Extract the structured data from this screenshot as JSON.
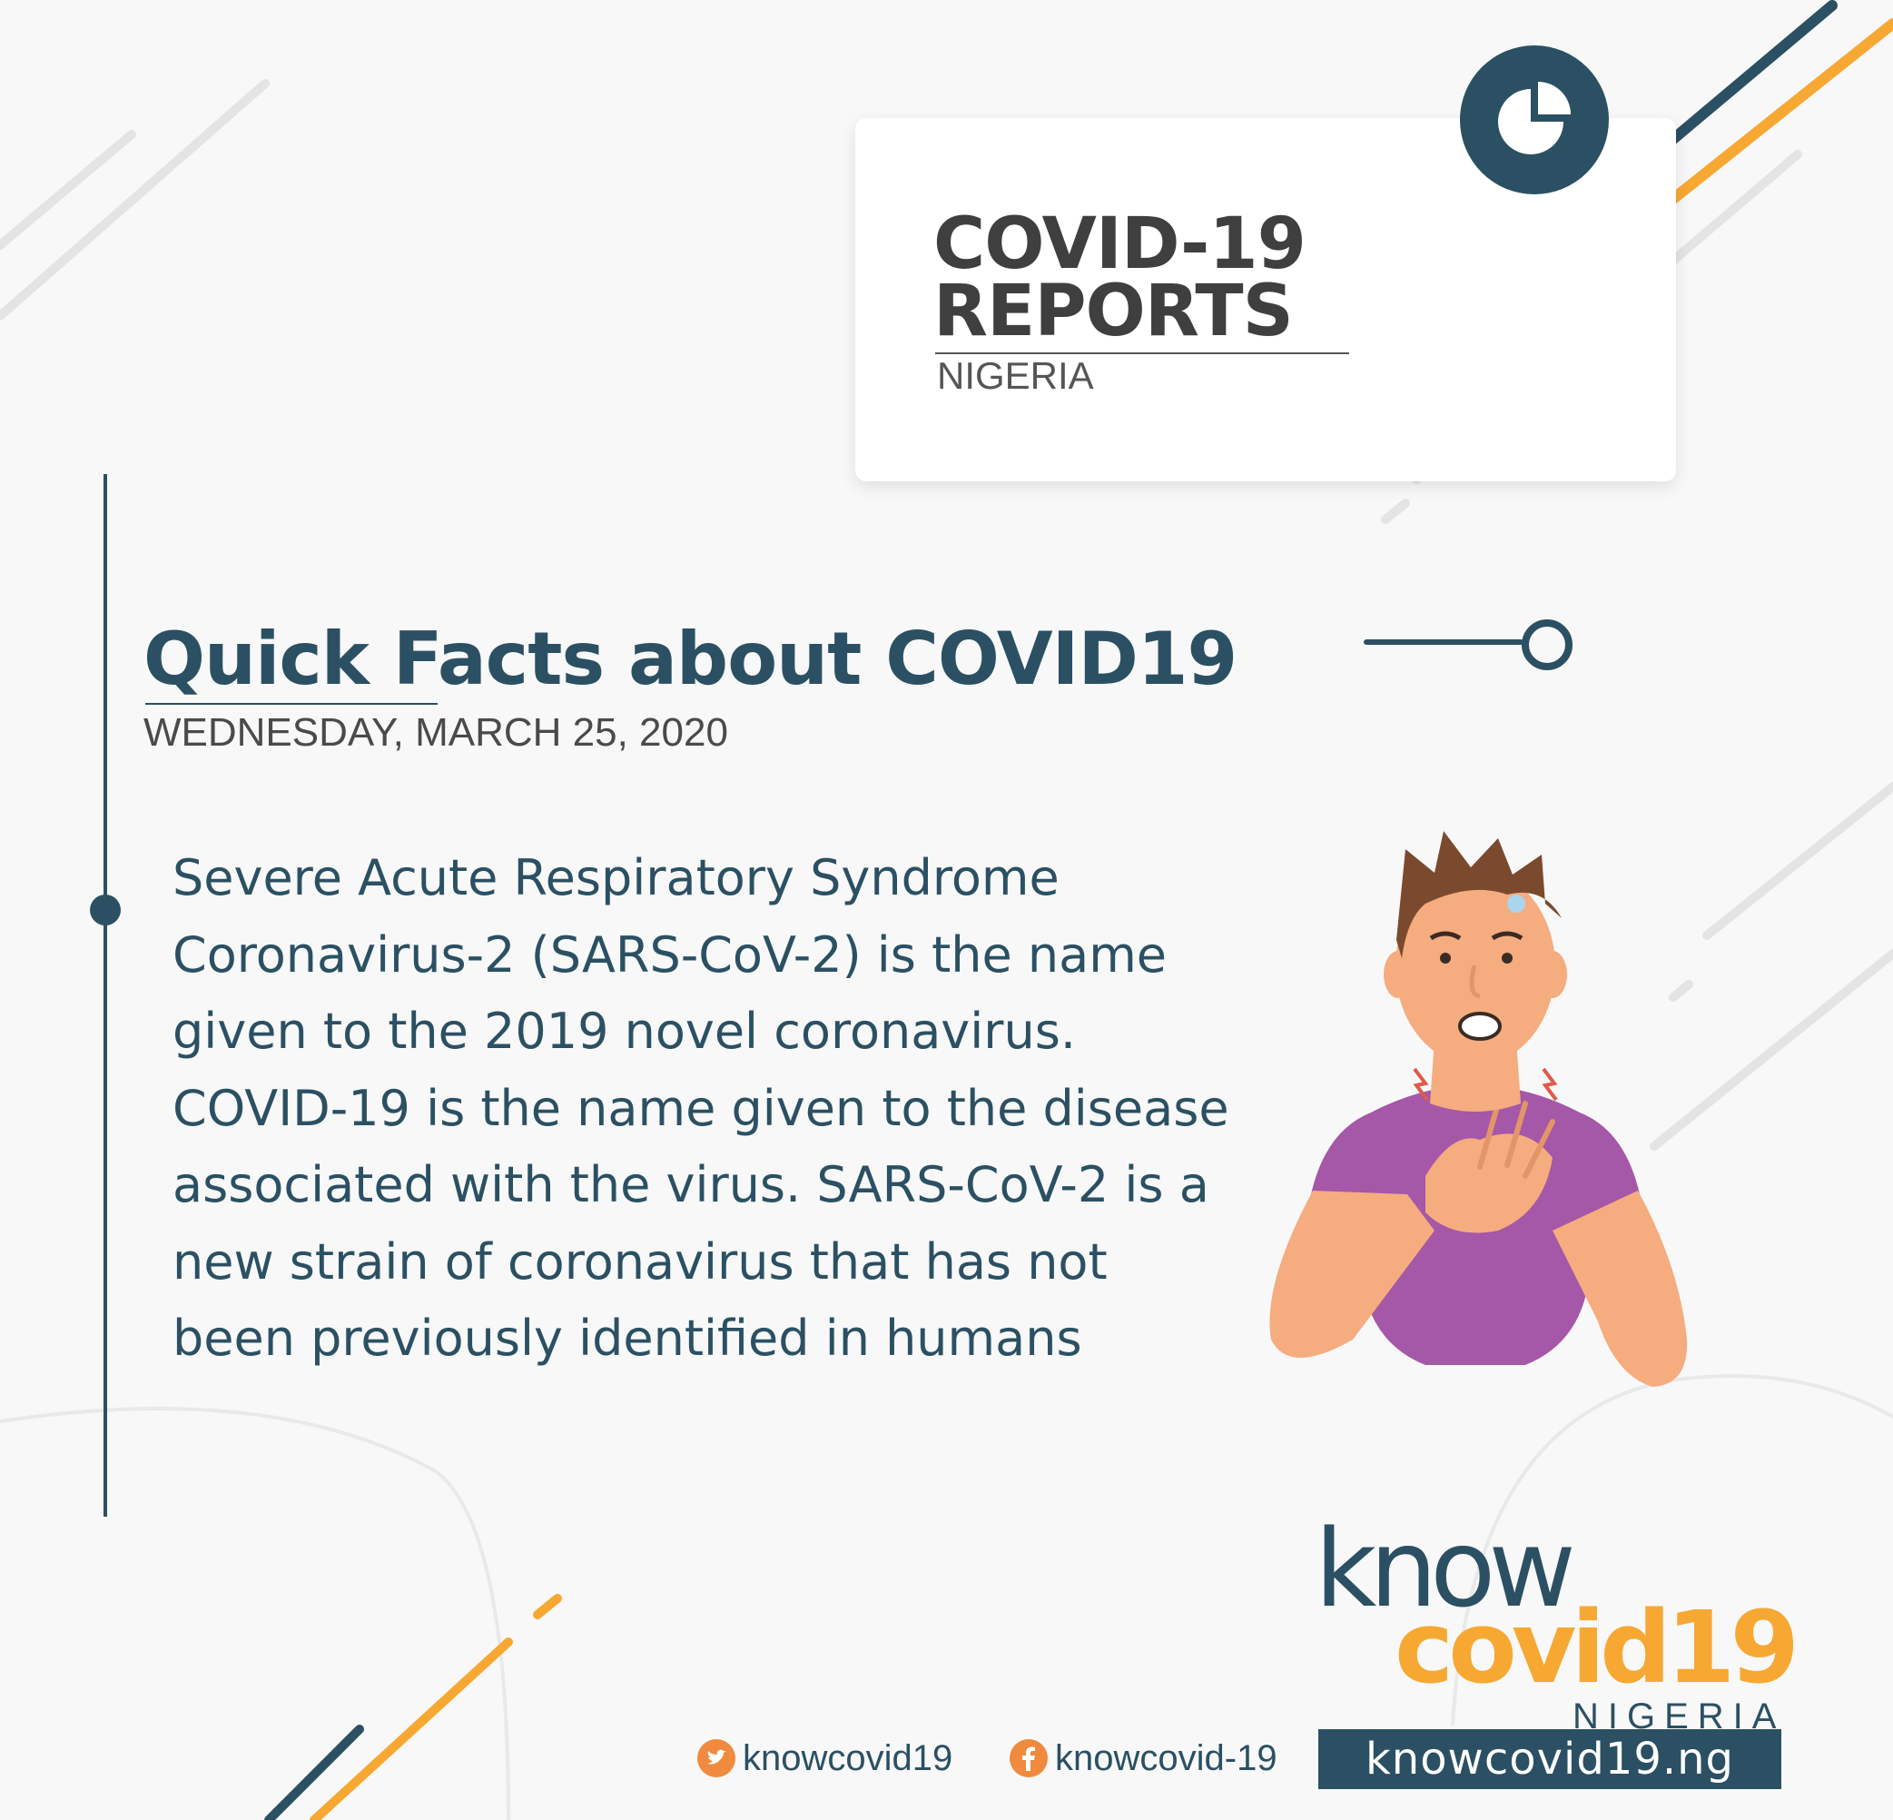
{
  "card": {
    "title_line1": "COVID-19",
    "title_line2": "REPORTS",
    "subtitle": "NIGERIA"
  },
  "heading": "Quick Facts about COVID19",
  "date": "WEDNESDAY, MARCH 25, 2020",
  "body_lines": [
    "Severe Acute Respiratory Syndrome",
    "Coronavirus-2 (SARS-CoV-2) is the name",
    "given to the 2019 novel coronavirus.",
    "COVID-19 is the name given to the disease",
    "associated with the virus. SARS-CoV-2 is a",
    "new strain of coronavirus that has not",
    "been previously identified in humans"
  ],
  "logo": {
    "know": "know",
    "covid": "covid19",
    "country": "NIGERIA"
  },
  "footer": {
    "twitter": "knowcovid19",
    "facebook": "knowcovid-19",
    "website": "knowcovid19.ng"
  },
  "icons": {
    "badge": "pie-chart-icon",
    "twitter": "twitter-icon",
    "facebook": "facebook-icon"
  },
  "colors": {
    "navy": "#2b5063",
    "orange": "#f7a833",
    "background": "#f8f8f8",
    "shirt": "#a557a8",
    "skin": "#f5ac7f"
  }
}
